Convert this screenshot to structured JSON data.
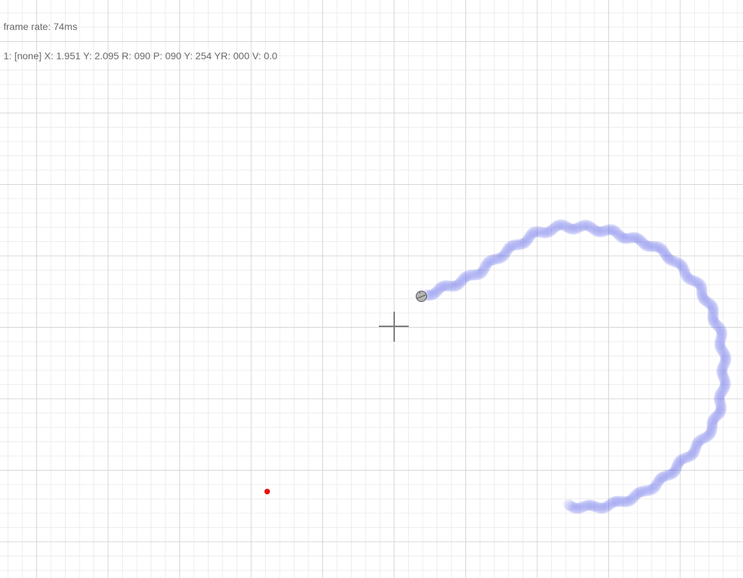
{
  "hud": {
    "frame_rate_text": "frame rate: 74ms",
    "status_text": "1: [none] X: 1.951 Y: 2.095 R: 090 P: 090 Y: 254 YR: 000 V: 0.0"
  },
  "colors": {
    "trail": "#4a57e8",
    "target_dot": "#e8120c",
    "crosshair": "#7a7a7a",
    "grid_major": "#d4d4d4",
    "grid_minor": "#ececec"
  },
  "icons": {
    "drone": "circle-marker-icon",
    "crosshair": "crosshair-icon",
    "target": "target-dot-icon"
  }
}
